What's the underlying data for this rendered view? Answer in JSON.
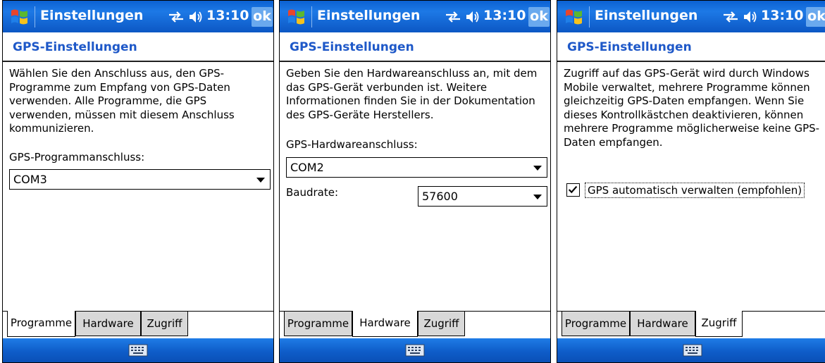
{
  "screens": [
    {
      "title": "Einstellungen",
      "time": "13:10",
      "ok": "ok",
      "section": "GPS-Einstellungen",
      "description": "Wählen Sie den Anschluss aus, den GPS-Programme zum Empfang von GPS-Daten verwenden. Alle Programme, die GPS verwenden, müssen mit diesem Anschluss kommunizieren.",
      "label1": "GPS-Programmanschluss:",
      "combo1": "COM3",
      "tabs": [
        "Programme",
        "Hardware",
        "Zugriff"
      ],
      "active_tab": "Programme"
    },
    {
      "title": "Einstellungen",
      "time": "13:10",
      "ok": "ok",
      "section": "GPS-Einstellungen",
      "description": "Geben Sie den Hardwareanschluss an, mit dem das GPS-Gerät verbunden ist. Weitere Informationen finden Sie in der Dokumentation des GPS-Geräte Herstellers.",
      "label1": "GPS-Hardwareanschluss:",
      "combo1": "COM2",
      "label2": "Baudrate:",
      "combo2": "57600",
      "tabs": [
        "Programme",
        "Hardware",
        "Zugriff"
      ],
      "active_tab": "Hardware"
    },
    {
      "title": "Einstellungen",
      "time": "13:10",
      "ok": "ok",
      "section": "GPS-Einstellungen",
      "description": "Zugriff auf das GPS-Gerät wird durch Windows Mobile verwaltet, mehrere Programme können gleichzeitig GPS-Daten empfangen. Wenn Sie dieses Kontrollkästchen deaktivieren, können mehrere Programme möglicherweise keine GPS-Daten empfangen.",
      "checkbox_label": "GPS automatisch verwalten (empfohlen)",
      "checkbox_checked": true,
      "tabs": [
        "Programme",
        "Hardware",
        "Zugriff"
      ],
      "active_tab": "Zugriff"
    }
  ],
  "colors": {
    "titlebar": "#0a5fd0",
    "section_title": "#1e58c8",
    "ok_button": "#6aa9ee"
  },
  "icons": {
    "logo": "windows-logo-icon",
    "connectivity": "connectivity-icon",
    "volume": "speaker-icon",
    "keyboard": "keyboard-icon"
  }
}
